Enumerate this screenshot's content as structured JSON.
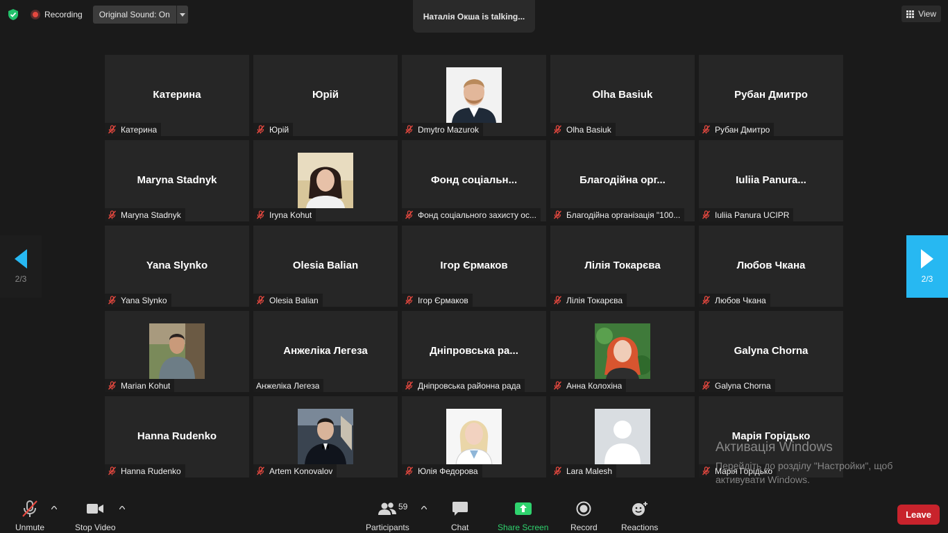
{
  "top": {
    "recording_label": "Recording",
    "original_sound_label": "Original Sound: On",
    "talking_notice": "Наталія Окша is talking...",
    "view_label": "View"
  },
  "pager": {
    "left_page": "2/3",
    "right_page": "2/3"
  },
  "tiles": [
    {
      "big": "Катерина",
      "label": "Катерина",
      "muted": true,
      "photo": ""
    },
    {
      "big": "Юрій",
      "label": "Юрій",
      "muted": true,
      "photo": ""
    },
    {
      "big": "",
      "label": "Dmytro Mazurok",
      "muted": true,
      "photo": "man-suit"
    },
    {
      "big": "Olha Basiuk",
      "label": "Olha Basiuk",
      "muted": true,
      "photo": ""
    },
    {
      "big": "Рубан Дмитро",
      "label": "Рубан Дмитро",
      "muted": true,
      "photo": ""
    },
    {
      "big": "Maryna Stadnyk",
      "label": "Maryna Stadnyk",
      "muted": true,
      "photo": ""
    },
    {
      "big": "",
      "label": "Iryna Kohut",
      "muted": true,
      "photo": "woman-dark-hair"
    },
    {
      "big": "Фонд соціальн...",
      "label": "Фонд соціального захисту ос...",
      "muted": true,
      "photo": ""
    },
    {
      "big": "Благодійна орг...",
      "label": "Благодійна організація \"100...",
      "muted": true,
      "photo": ""
    },
    {
      "big": "Iuliia Panura...",
      "label": "Iuliia Panura     UCIPR",
      "muted": true,
      "photo": ""
    },
    {
      "big": "Yana Slynko",
      "label": "Yana Slynko",
      "muted": true,
      "photo": ""
    },
    {
      "big": "Olesia Balian",
      "label": "Olesia Balian",
      "muted": true,
      "photo": ""
    },
    {
      "big": "Ігор Єрмаков",
      "label": "Ігор Єрмаков",
      "muted": true,
      "photo": ""
    },
    {
      "big": "Лілія Токарєва",
      "label": "Лілія Токарєва",
      "muted": true,
      "photo": ""
    },
    {
      "big": "Любов Чкана",
      "label": "Любов Чкана",
      "muted": true,
      "photo": ""
    },
    {
      "big": "",
      "label": "Marian Kohut",
      "muted": true,
      "photo": "man-outdoor"
    },
    {
      "big": "Анжеліка Легеза",
      "label": "Анжеліка Легеза",
      "muted": false,
      "photo": ""
    },
    {
      "big": "Дніпровська ра...",
      "label": "Дніпровська районна рада",
      "muted": true,
      "photo": ""
    },
    {
      "big": "",
      "label": "Анна Колохіна",
      "muted": true,
      "photo": "woman-red-hair"
    },
    {
      "big": "Galyna Chorna",
      "label": "Galyna Chorna",
      "muted": true,
      "photo": ""
    },
    {
      "big": "Hanna Rudenko",
      "label": "Hanna Rudenko",
      "muted": true,
      "photo": ""
    },
    {
      "big": "",
      "label": "Artem Konovalov",
      "muted": true,
      "photo": "man-bowtie"
    },
    {
      "big": "",
      "label": "Юлія Федорова",
      "muted": true,
      "photo": "woman-blonde"
    },
    {
      "big": "",
      "label": "Lara Malesh",
      "muted": true,
      "photo": "avatar-placeholder"
    },
    {
      "big": "Марія Горідько",
      "label": "Марія Горідько",
      "muted": true,
      "photo": ""
    }
  ],
  "watermark": {
    "title": "Активація Windows",
    "subtitle": "Перейдіть до розділу \"Настройки\", щоб активувати Windows."
  },
  "toolbar": {
    "unmute_label": "Unmute",
    "stop_video_label": "Stop Video",
    "participants_label": "Participants",
    "participants_count": "59",
    "chat_label": "Chat",
    "share_label": "Share Screen",
    "record_label": "Record",
    "reactions_label": "Reactions",
    "leave_label": "Leave"
  },
  "colors": {
    "share_accent": "#2fd36e",
    "page_arrow_active": "#27b8f2",
    "leave_button": "#c8232c",
    "muted_red": "#e5483f"
  }
}
